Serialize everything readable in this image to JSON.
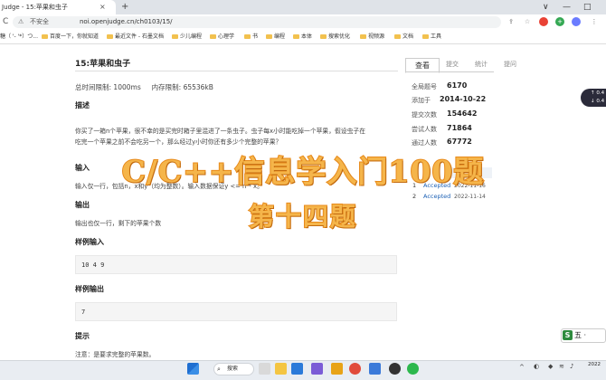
{
  "browser": {
    "tab_title": "Judge - 15:苹果和虫子",
    "tab_close": "×",
    "new_tab": "+",
    "window_controls": [
      "∨",
      "—",
      "□"
    ],
    "reload_icon": "C",
    "security_label": "不安全",
    "url": "noi.openjudge.cn/ch0103/15/",
    "bookmarks": [
      "糖（ '- '*）つ...",
      "百度一下，你就知道",
      "最近文件 - 石墨文档",
      "少儿编程",
      "心理学",
      "书",
      "编程",
      "本体",
      "搜索优化",
      "视频源",
      "文档",
      "工具"
    ]
  },
  "problem": {
    "title": "15:苹果和虫子",
    "time_limit_label": "总时间限制:",
    "time_limit": "1000ms",
    "memory_limit_label": "内存限制:",
    "memory_limit": "65536kB",
    "desc_heading": "描述",
    "desc_line1": "你买了一箱n个苹果，很不幸的是买完时箱子里混进了一条虫子。虫子每x小时能吃掉一个苹果，假设虫子在",
    "desc_line2": "吃完一个苹果之前不会吃另一个，那么经过y小时你还有多少个完整的苹果？",
    "input_heading": "输入",
    "input_text": "输入仅一行，包括n，x和y（均为整数）。输入数据保证y <= n * x。",
    "output_heading": "输出",
    "output_text": "输出也仅一行，剩下的苹果个数",
    "sample_input_heading": "样例输入",
    "sample_input": "10 4 9",
    "sample_output_heading": "样例输出",
    "sample_output": "7",
    "hint_heading": "提示",
    "hint_text": "注意：是要求完整的苹果数。"
  },
  "side": {
    "tabs": [
      "查看",
      "提交",
      "统计",
      "提问"
    ],
    "stats": [
      {
        "label": "全局题号",
        "value": "6170"
      },
      {
        "label": "添加于",
        "value": "2014-10-22"
      },
      {
        "label": "提交次数",
        "value": "154642"
      },
      {
        "label": "尝试人数",
        "value": "71864"
      },
      {
        "label": "通过人数",
        "value": "67772"
      }
    ],
    "submissions_head": "间",
    "submissions": [
      {
        "n": "1",
        "status": "Accepted",
        "date": "2022-11-16"
      },
      {
        "n": "2",
        "status": "Accepted",
        "date": "2022-11-14"
      }
    ]
  },
  "overlay": {
    "line1": "C/C++信息学入门100题",
    "line2": "第十四题"
  },
  "widgets": {
    "speed_up": "↑ 0.4",
    "speed_down": "↓ 0.4",
    "ime_label": "五 ·",
    "ime_logo": "S"
  },
  "taskbar": {
    "search_label": "搜索",
    "clock": "2022"
  }
}
